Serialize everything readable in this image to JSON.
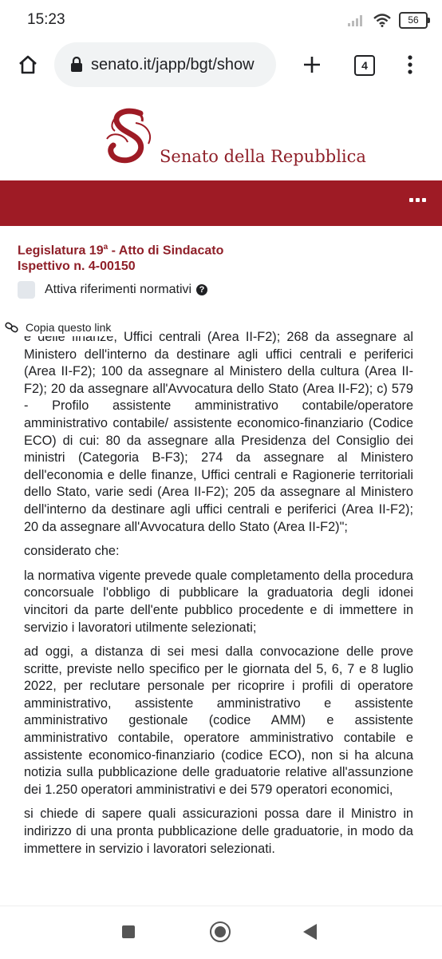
{
  "status": {
    "time": "15:23",
    "battery": "56"
  },
  "browser": {
    "url": "senato.it/japp/bgt/show",
    "tab_count": "4"
  },
  "site": {
    "name": "Senato della Repubblica"
  },
  "act": {
    "title_line1_pre": "Legislatura 19",
    "title_sup": "a",
    "title_line1_post": " - Atto di Sindacato",
    "title_line2": "Ispettivo n. 4-00150"
  },
  "options": {
    "refs_label": "Attiva riferimenti normativi"
  },
  "copy_link": {
    "label": "Copia questo link"
  },
  "content": {
    "paragraphs": [
      "e delle finanze, Uffici centrali (Area II-F2); 268 da assegnare al Ministero dell'interno da destinare agli uffici centrali e periferici (Area II-F2); 100 da assegnare al Ministero della cultura (Area II-F2); 20 da assegnare all'Avvocatura dello Stato (Area II-F2); c) 579 - Profilo assistente amministrativo contabile/operatore amministrativo contabile/ assistente economico-finanziario (Codice ECO) di cui: 80 da assegnare alla Presidenza del Consiglio dei ministri (Categoria B-F3); 274 da assegnare al Ministero dell'economia e delle finanze, Uffici centrali e Ragionerie territoriali dello Stato, varie sedi (Area II-F2); 205 da assegnare al Ministero dell'interno da destinare agli uffici centrali e periferici (Area II-F2); 20 da assegnare all'Avvocatura dello Stato (Area II-F2)\";",
      "considerato che:",
      "la normativa vigente prevede quale completamento della procedura concorsuale l'obbligo di pubblicare la graduatoria degli idonei vincitori da parte dell'ente pubblico procedente e di immettere in servizio i lavoratori utilmente selezionati;",
      "ad oggi, a distanza di sei mesi dalla convocazione delle prove scritte, previste nello specifico per le giornata del 5, 6, 7 e 8 luglio 2022, per reclutare personale per ricoprire i profili di operatore amministrativo, assistente amministrativo e assistente amministrativo gestionale (codice AMM) e assistente amministrativo contabile, operatore amministrativo contabile e assistente economico-finanziario (codice ECO), non si ha alcuna notizia sulla pubblicazione delle graduatorie relative all'assunzione dei 1.250 operatori amministrativi e dei 579 operatori economici,",
      "si chiede di sapere quali assicurazioni possa dare il Ministro in indirizzo di una pronta pubblicazione delle graduatorie, in modo da immettere in servizio i lavoratori selezionati."
    ]
  },
  "colors": {
    "brand_red": "#9e1b25",
    "title_red": "#8f1f28"
  }
}
